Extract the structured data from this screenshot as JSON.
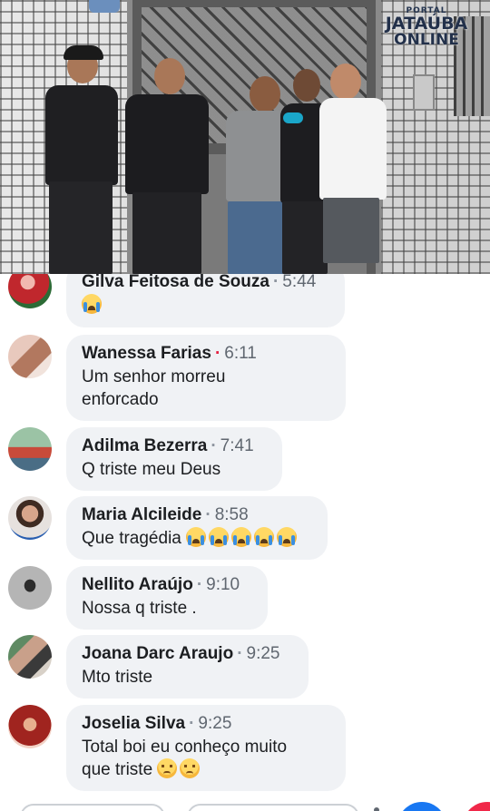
{
  "video": {
    "logo": {
      "line1": "PORTAL",
      "line2": "JATAÚBA",
      "line3": "ONLINE"
    }
  },
  "comments": [
    {
      "name": "Gilva Feitosa de Souza",
      "time": "5:44",
      "text": "",
      "emoji": [
        "crying-face"
      ],
      "avatar_color": "#c0272d",
      "sep_color": "#8d949e"
    },
    {
      "name": "Wanessa Farias",
      "time": "6:11",
      "text_lines": [
        "Um senhor morreu",
        "enforcado"
      ],
      "avatar_color": "#c98a7a",
      "sep_color": "#e41e3f"
    },
    {
      "name": "Adilma Bezerra",
      "time": "7:41",
      "text": "Q triste  meu Deus",
      "avatar_color": "#5b8f6a",
      "sep_color": "#8d949e"
    },
    {
      "name": "Maria Alcileide",
      "time": "8:58",
      "text": "Que tragédia",
      "emoji": [
        "crying-face",
        "crying-face",
        "crying-face",
        "crying-face",
        "crying-face"
      ],
      "avatar_color": "#d9d3cf",
      "sep_color": "#8d949e"
    },
    {
      "name": "Nellito Araújo",
      "time": "9:10",
      "text": "Nossa q triste .",
      "avatar_color": "#8f8f8f",
      "sep_color": "#8d949e"
    },
    {
      "name": "Joana Darc Araujo",
      "time": "9:25",
      "text": "Mto triste",
      "avatar_color": "#7d6a5c",
      "sep_color": "#8d949e"
    },
    {
      "name": "Joselia Silva",
      "time": "9:25",
      "text_lines": [
        "Total boi eu conheço muito",
        "que triste"
      ],
      "emoji": [
        "pensive-face",
        "pensive-face"
      ],
      "avatar_color": "#a0241f",
      "sep_color": "#8d949e"
    }
  ],
  "colors": {
    "bubble": "#f0f2f5",
    "name": "#1c1e21",
    "time": "#606770",
    "live_dot": "#e41e3f",
    "accent_blue": "#1877f2"
  }
}
